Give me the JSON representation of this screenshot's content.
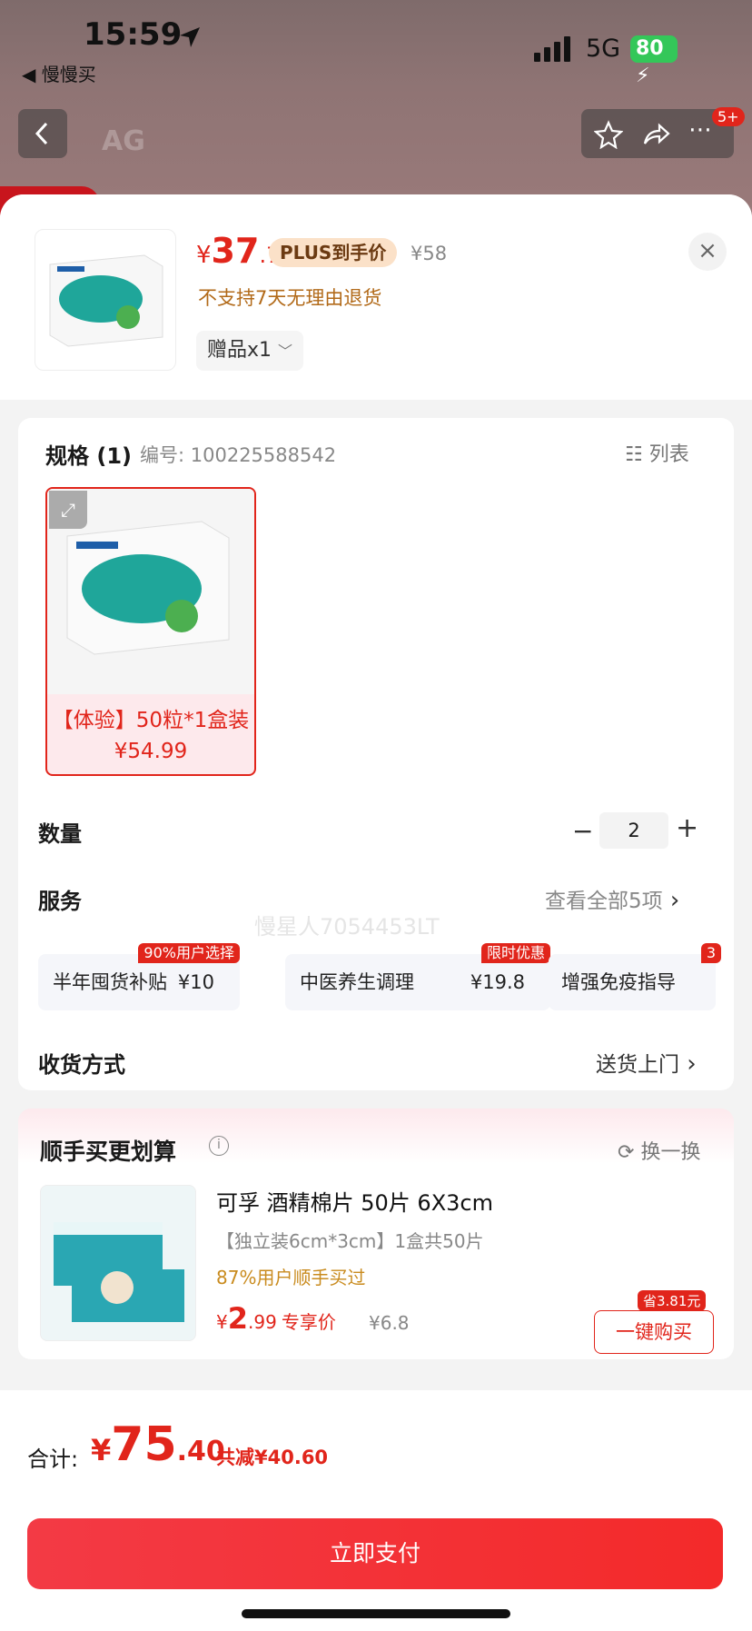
{
  "status_bar": {
    "time": "15:59",
    "back_app": "◀ 慢慢买",
    "network": "5G",
    "battery": "80"
  },
  "nav": {
    "badge": "5+",
    "logo_hint": "AG"
  },
  "product": {
    "price_symbol": "¥",
    "price_int": "37",
    "price_dec": ".7",
    "plus_label": "PLUS到手价",
    "original_price": "¥58",
    "no_return": "不支持7天无理由退货",
    "gift": "赠品x1"
  },
  "spec": {
    "title": "规格 (1)",
    "number_label": "编号: 100225588542",
    "list_label": "列表",
    "sku_label": "【体验】50粒*1盒装 ¥54.99",
    "watermark": "慢星人7054453LT"
  },
  "quantity": {
    "label": "数量",
    "value": "2",
    "minus": "−",
    "plus": "+"
  },
  "service": {
    "label": "服务",
    "view_all": "查看全部5项",
    "items": [
      {
        "name": "半年囤货补贴",
        "price": "¥10",
        "badge": "90%用户选择"
      },
      {
        "name": "中医养生调理",
        "price": "¥19.8",
        "badge": "限时优惠"
      },
      {
        "name": "增强免疫指导",
        "price": "",
        "badge": "3"
      }
    ]
  },
  "delivery": {
    "label": "收货方式",
    "value": "送货上门"
  },
  "addon": {
    "title": "顺手买更划算",
    "swap": "换一换",
    "name": "可孚 酒精棉片 50片 6X3cm",
    "desc": "【独立装6cm*3cm】1盒共50片",
    "percent": "87%用户顺手买过",
    "price_symbol": "¥",
    "price_int": "2",
    "price_dec": ".99",
    "exclusive": "专享价",
    "original": "¥6.8",
    "save_tag": "省3.81元",
    "buy": "一键购买"
  },
  "footer": {
    "total_label": "合计:",
    "total_symbol": "¥",
    "total_int": "75",
    "total_dec": ".40",
    "discount": "共减¥40.60",
    "pay": "立即支付"
  },
  "colors": {
    "accent": "#e1251b",
    "plus_bg": "#fbe1c8",
    "battery": "#34c759"
  }
}
